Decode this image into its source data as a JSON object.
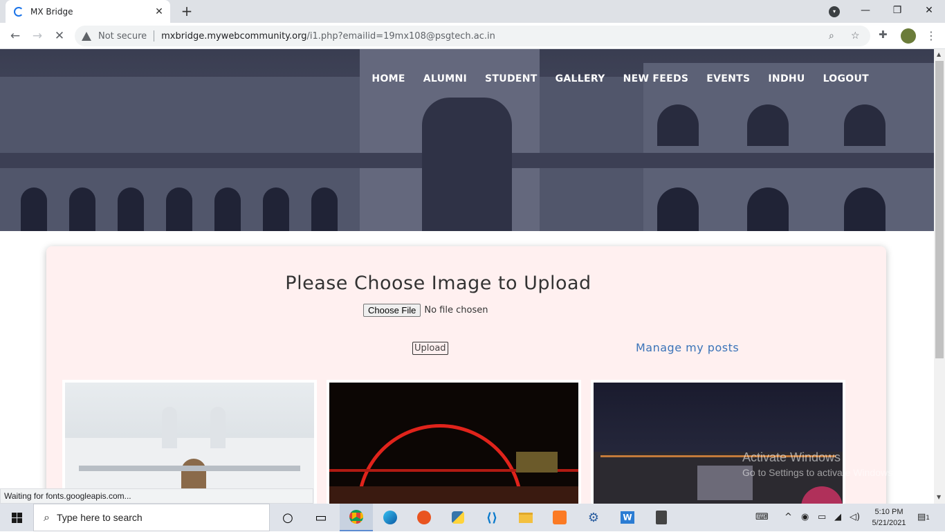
{
  "browser": {
    "tab_title": "MX Bridge",
    "not_secure": "Not secure",
    "url_host": "mxbridge.mywebcommunity.org",
    "url_path": "/i1.php?emailid=19mx108@psgtech.ac.in",
    "status_text": "Waiting for fonts.googleapis.com..."
  },
  "nav": {
    "items": [
      "HOME",
      "ALUMNI",
      "STUDENT",
      "GALLERY",
      "NEW FEEDS",
      "EVENTS",
      "INDHU",
      "LOGOUT"
    ]
  },
  "upload": {
    "title": "Please Choose Image to Upload",
    "choose_label": "Choose File",
    "no_file": "No file chosen",
    "upload_label": "Upload",
    "manage_label": "Manage my posts"
  },
  "watermark": {
    "line1": "Activate Windows",
    "line2": "Go to Settings to activate Windows."
  },
  "taskbar": {
    "search_placeholder": "Type here to search",
    "time": "5:10 PM",
    "date": "5/21/2021",
    "notification_count": "1"
  },
  "colors": {
    "panel_bg": "#fff0f0",
    "link": "#3a73b8",
    "hero_tint": "#4a4e63"
  }
}
